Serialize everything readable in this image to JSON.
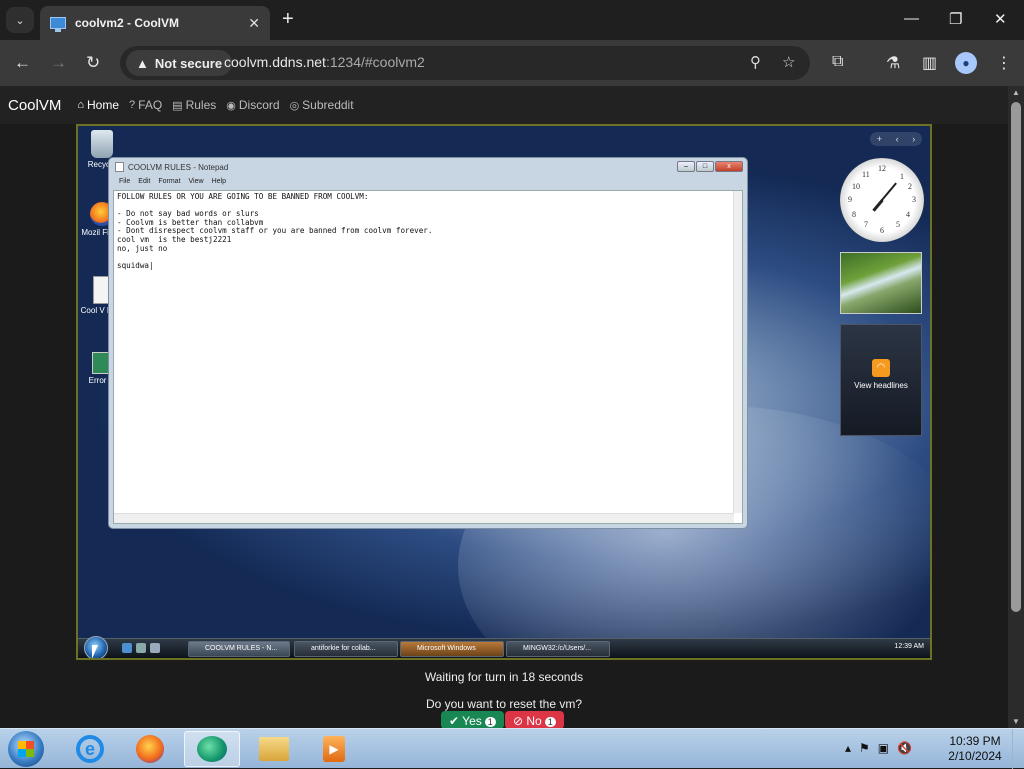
{
  "browser": {
    "tab_title": "coolvm2 - CoolVM",
    "tab_close": "✕",
    "new_tab": "+",
    "security_label": "Not secure",
    "url_host": "coolvm.ddns.net",
    "url_rest": ":1234/#coolvm2"
  },
  "site_nav": {
    "brand": "CoolVM",
    "links": [
      {
        "label": "Home",
        "icon": "home-icon"
      },
      {
        "label": "FAQ",
        "icon": "question-icon"
      },
      {
        "label": "Rules",
        "icon": "clipboard-icon"
      },
      {
        "label": "Discord",
        "icon": "discord-icon"
      },
      {
        "label": "Subreddit",
        "icon": "reddit-icon"
      }
    ]
  },
  "vm_desktop": {
    "icons": [
      {
        "label": "Recycle"
      },
      {
        "label": "Mozil Firefo"
      },
      {
        "label": "Cool V Rule"
      },
      {
        "label": "Error m"
      }
    ],
    "feed_label": "View headlines",
    "notepad": {
      "title": "COOLVM RULES - Notepad",
      "menu": [
        "File",
        "Edit",
        "Format",
        "View",
        "Help"
      ],
      "text": "FOLLOW RULES OR YOU ARE GOING TO BE BANNED FROM COOLVM:\n\n- Do not say bad words or slurs\n- Coolvm is better than collabvm\n- Dont disrespect coolvm staff or you are banned from coolvm forever.\ncool vm  is the bestj2221\nno, just no\n\nsquidwa|"
    },
    "taskbar": {
      "buttons": [
        "COOLVM RULES - N...",
        "antiforkie for collab...",
        "Microsoft Windows",
        "MINGW32:/c/Users/..."
      ],
      "time": "12:39 AM"
    }
  },
  "turn_status": "Waiting for turn in 18 seconds",
  "reset_question": "Do you want to reset the vm?",
  "vote": {
    "yes_label": "Yes",
    "yes_count": "1",
    "no_label": "No",
    "no_count": "1"
  },
  "host_taskbar": {
    "time": "10:39 PM",
    "date": "2/10/2024"
  },
  "colors": {
    "yes": "#198754",
    "no": "#dc3545",
    "vm_border": "#6b7322"
  }
}
